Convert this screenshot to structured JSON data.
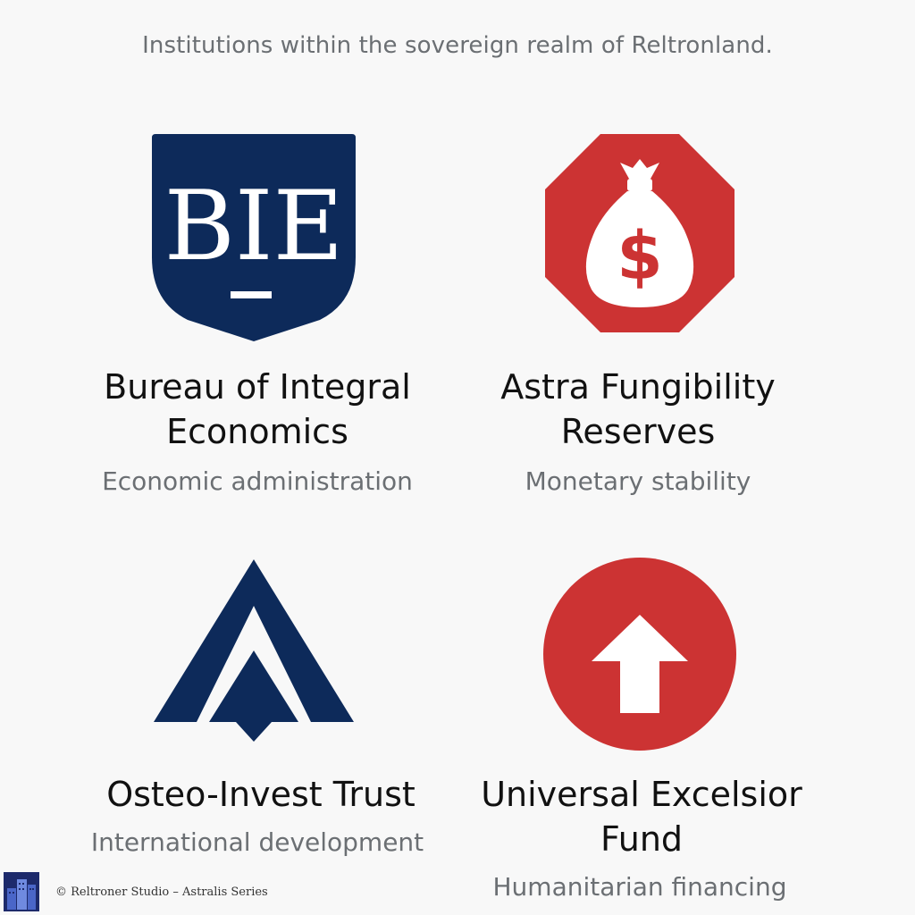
{
  "header": {
    "caption": "Institutions within the sovereign realm of Reltronland."
  },
  "colors": {
    "navy": "#0d2a5a",
    "red": "#cc3333",
    "background": "#f8f8f8"
  },
  "institutions": [
    {
      "name": "Bureau of Integral Economics",
      "description": "Economic administration",
      "logo_icon": "shield-icon",
      "logo_text": "BIE"
    },
    {
      "name": "Astra Fungibility Reserves",
      "description": "Monetary stability",
      "logo_icon": "money-bag-icon",
      "logo_text": "$"
    },
    {
      "name": "Osteo-Invest Trust",
      "description": "International development",
      "logo_icon": "chevron-up-icon"
    },
    {
      "name": "Universal Excelsior Fund",
      "description": "Humanitarian financing",
      "logo_icon": "arrow-up-icon"
    }
  ],
  "footer": {
    "credit": "© Reltroner Studio – Astralis Series",
    "icon": "city-buildings-icon"
  }
}
